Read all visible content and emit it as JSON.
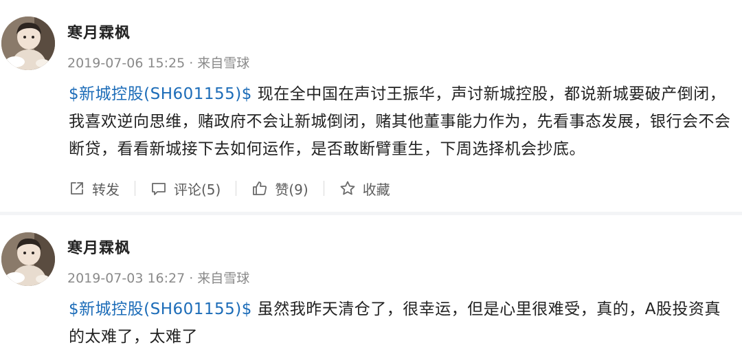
{
  "posts": [
    {
      "author": "寒月霖枫",
      "date": "2019-07-06 15:25",
      "separator": "·",
      "source": "来自雪球",
      "stock_tag": "$新城控股(SH601155)$",
      "text": " 现在全中国在声讨王振华，声讨新城控股，都说新城要破产倒闭，我喜欢逆向思维，赌政府不会让新城倒闭，赌其他董事能力作为，先看事态发展，银行会不会断贷，看看新城接下去如何运作，是否敢断臂重生，下周选择机会抄底。",
      "actions": {
        "retweet": "转发",
        "comment": "评论(5)",
        "like": "赞(9)",
        "favorite": "收藏"
      }
    },
    {
      "author": "寒月霖枫",
      "date": "2019-07-03 16:27",
      "separator": "·",
      "source": "来自雪球",
      "stock_tag": "$新城控股(SH601155)$",
      "text": " 虽然我昨天清仓了，很幸运，但是心里很难受，真的，A股投资真的太难了，太难了"
    }
  ],
  "icons": {
    "retweet": "share-out-icon",
    "comment": "comment-bubble-icon",
    "like": "thumbs-up-icon",
    "favorite": "star-icon"
  },
  "colors": {
    "stock_link": "#1c6cb8",
    "meta": "#8a8a8a",
    "divider": "#f3f4f6"
  }
}
